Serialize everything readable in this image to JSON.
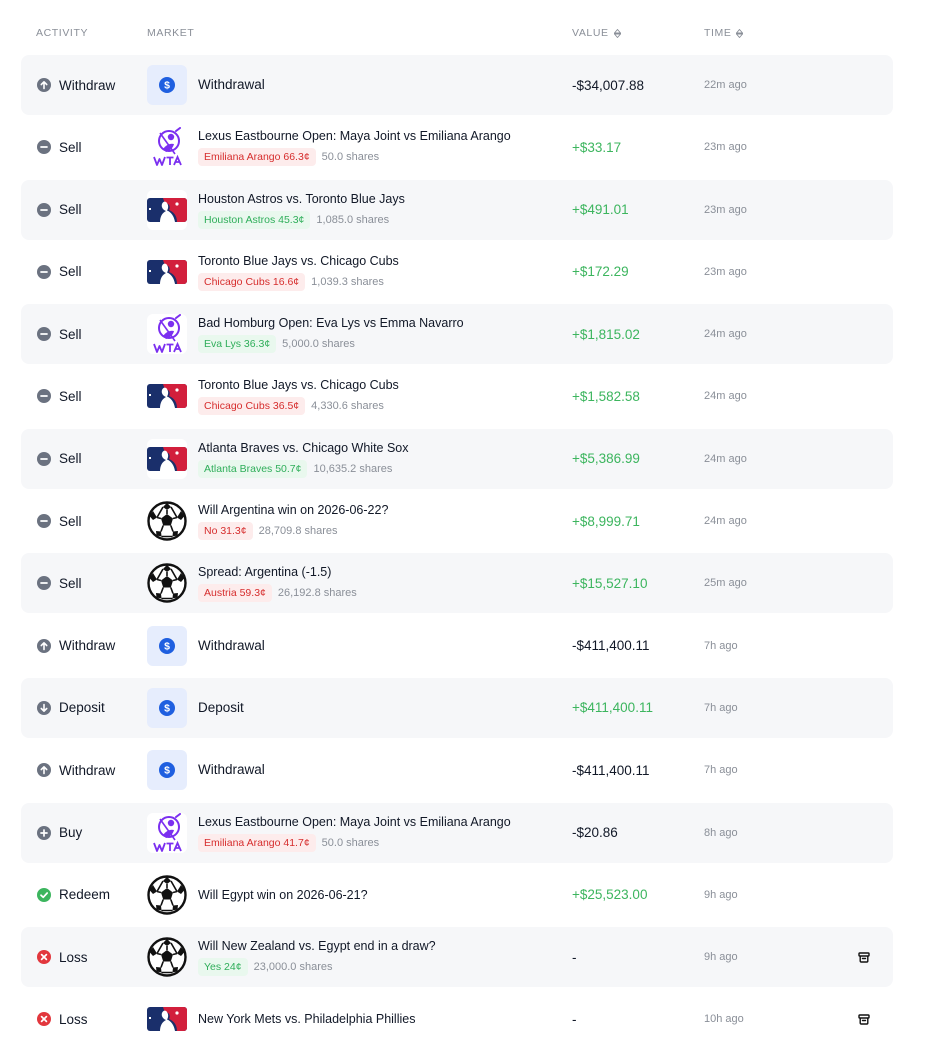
{
  "columns": {
    "activity": "ACTIVITY",
    "market": "MARKET",
    "value": "VALUE",
    "time": "TIME"
  },
  "colors": {
    "positive": "#3cb55e",
    "negative_pill": "#d62d2d",
    "positive_pill": "#2fae5a",
    "usd_icon": "#1f5fe0",
    "mlb_blue": "#1a2f6b",
    "mlb_red": "#d21f3c",
    "wta_purple": "#7b2ff0"
  },
  "rows": [
    {
      "activity": "Withdraw",
      "activity_icon": "arrow-up-circle-icon",
      "market_icon": "usd",
      "title": "Withdrawal",
      "value": "-$34,007.88",
      "value_sign": "neg",
      "time": "22m ago"
    },
    {
      "activity": "Sell",
      "activity_icon": "minus-circle-icon",
      "market_icon": "wta",
      "title": "Lexus Eastbourne Open: Maya Joint vs Emiliana Arango",
      "pill": "Emiliana Arango 66.3¢",
      "pill_color": "red",
      "shares": "50.0 shares",
      "value": "+$33.17",
      "value_sign": "pos",
      "time": "23m ago"
    },
    {
      "activity": "Sell",
      "activity_icon": "minus-circle-icon",
      "market_icon": "mlb",
      "title": "Houston Astros vs. Toronto Blue Jays",
      "pill": "Houston Astros 45.3¢",
      "pill_color": "green",
      "shares": "1,085.0 shares",
      "value": "+$491.01",
      "value_sign": "pos",
      "time": "23m ago"
    },
    {
      "activity": "Sell",
      "activity_icon": "minus-circle-icon",
      "market_icon": "mlb",
      "title": "Toronto Blue Jays vs. Chicago Cubs",
      "pill": "Chicago Cubs 16.6¢",
      "pill_color": "red",
      "shares": "1,039.3 shares",
      "value": "+$172.29",
      "value_sign": "pos",
      "time": "23m ago"
    },
    {
      "activity": "Sell",
      "activity_icon": "minus-circle-icon",
      "market_icon": "wta",
      "title": "Bad Homburg Open: Eva Lys vs Emma Navarro",
      "pill": "Eva Lys 36.3¢",
      "pill_color": "green",
      "shares": "5,000.0 shares",
      "value": "+$1,815.02",
      "value_sign": "pos",
      "time": "24m ago"
    },
    {
      "activity": "Sell",
      "activity_icon": "minus-circle-icon",
      "market_icon": "mlb",
      "title": "Toronto Blue Jays vs. Chicago Cubs",
      "pill": "Chicago Cubs 36.5¢",
      "pill_color": "red",
      "shares": "4,330.6 shares",
      "value": "+$1,582.58",
      "value_sign": "pos",
      "time": "24m ago"
    },
    {
      "activity": "Sell",
      "activity_icon": "minus-circle-icon",
      "market_icon": "mlb",
      "title": "Atlanta Braves vs. Chicago White Sox",
      "pill": "Atlanta Braves 50.7¢",
      "pill_color": "green",
      "shares": "10,635.2 shares",
      "value": "+$5,386.99",
      "value_sign": "pos",
      "time": "24m ago"
    },
    {
      "activity": "Sell",
      "activity_icon": "minus-circle-icon",
      "market_icon": "ball",
      "title": "Will Argentina win on 2026-06-22?",
      "pill": "No 31.3¢",
      "pill_color": "red",
      "shares": "28,709.8 shares",
      "value": "+$8,999.71",
      "value_sign": "pos",
      "time": "24m ago"
    },
    {
      "activity": "Sell",
      "activity_icon": "minus-circle-icon",
      "market_icon": "ball",
      "title": "Spread: Argentina (-1.5)",
      "pill": "Austria 59.3¢",
      "pill_color": "red",
      "shares": "26,192.8 shares",
      "value": "+$15,527.10",
      "value_sign": "pos",
      "time": "25m ago"
    },
    {
      "activity": "Withdraw",
      "activity_icon": "arrow-up-circle-icon",
      "market_icon": "usd",
      "title": "Withdrawal",
      "value": "-$411,400.11",
      "value_sign": "neg",
      "time": "7h ago"
    },
    {
      "activity": "Deposit",
      "activity_icon": "arrow-down-circle-icon",
      "market_icon": "usd",
      "title": "Deposit",
      "value": "+$411,400.11",
      "value_sign": "pos",
      "time": "7h ago"
    },
    {
      "activity": "Withdraw",
      "activity_icon": "arrow-up-circle-icon",
      "market_icon": "usd",
      "title": "Withdrawal",
      "value": "-$411,400.11",
      "value_sign": "neg",
      "time": "7h ago"
    },
    {
      "activity": "Buy",
      "activity_icon": "plus-circle-icon",
      "market_icon": "wta",
      "title": "Lexus Eastbourne Open: Maya Joint vs Emiliana Arango",
      "pill": "Emiliana Arango 41.7¢",
      "pill_color": "red",
      "shares": "50.0 shares",
      "value": "-$20.86",
      "value_sign": "neg",
      "time": "8h ago"
    },
    {
      "activity": "Redeem",
      "activity_icon": "check-circle-icon",
      "market_icon": "ball",
      "title": "Will Egypt win on 2026-06-21?",
      "value": "+$25,523.00",
      "value_sign": "pos",
      "time": "9h ago"
    },
    {
      "activity": "Loss",
      "activity_icon": "x-circle-icon",
      "market_icon": "ball",
      "title": "Will New Zealand vs. Egypt end in a draw?",
      "pill": "Yes 24¢",
      "pill_color": "green",
      "shares": "23,000.0 shares",
      "value": "-",
      "value_sign": "neg",
      "time": "9h ago",
      "trash": true
    },
    {
      "activity": "Loss",
      "activity_icon": "x-circle-icon",
      "market_icon": "mlb",
      "title": "New York Mets vs. Philadelphia Phillies",
      "value": "-",
      "value_sign": "neg",
      "time": "10h ago",
      "trash": true
    }
  ]
}
